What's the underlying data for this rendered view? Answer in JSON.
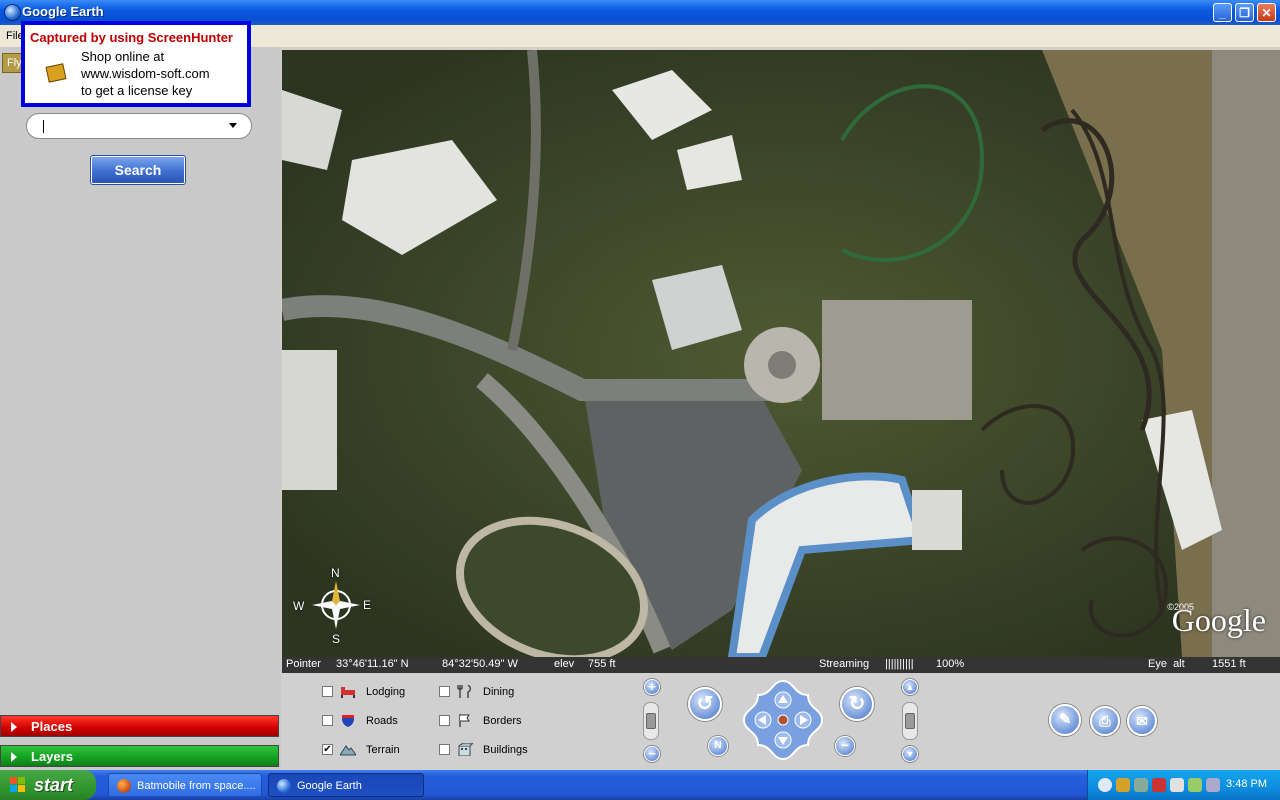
{
  "window": {
    "title": "Google Earth",
    "buttons": {
      "minimize": "_",
      "maximize": "❐",
      "close": "✕"
    }
  },
  "menubar": {
    "first_item": "File"
  },
  "left_panel": {
    "fly_tab": "Fly",
    "search_value": "",
    "search_button": "Search",
    "places": "Places",
    "layers": "Layers"
  },
  "watermark": {
    "title": "Captured by using ScreenHunter",
    "line1": "Shop online at",
    "line2": "www.wisdom-soft.com",
    "line3": "to get a license key"
  },
  "map": {
    "compass": {
      "n": "N",
      "s": "S",
      "e": "E",
      "w": "W"
    },
    "logo": "Google",
    "copyright": "©2005"
  },
  "status": {
    "pointer_label": "Pointer",
    "latitude": "33°46'11.16\" N",
    "longitude": "84°32'50.49\" W",
    "elev_label": "elev",
    "elev_value": "755 ft",
    "streaming_label": "Streaming",
    "streaming_bars": "||||||||||",
    "streaming_percent": "100%",
    "eye_alt_label": "Eye  alt",
    "eye_alt_value": "1551 ft",
    "streaming_progress": 1.0
  },
  "layers": [
    {
      "name": "Lodging",
      "checked": false,
      "icon": "bed-icon"
    },
    {
      "name": "Dining",
      "checked": false,
      "icon": "fork-knife-icon"
    },
    {
      "name": "Roads",
      "checked": false,
      "icon": "interstate-shield-icon"
    },
    {
      "name": "Borders",
      "checked": false,
      "icon": "flag-icon"
    },
    {
      "name": "Terrain",
      "checked": true,
      "icon": "mountain-icon"
    },
    {
      "name": "Buildings",
      "checked": false,
      "icon": "building-icon"
    }
  ],
  "taskbar": {
    "start": "start",
    "items": [
      {
        "label": "Batmobile from space....",
        "icon": "firefox-icon",
        "active": false
      },
      {
        "label": "Google Earth",
        "icon": "google-earth-icon",
        "active": true
      }
    ],
    "clock": "3:48 PM"
  },
  "colors": {
    "titlebar": "#0a5ae0",
    "places_bar": "#d10000",
    "layers_bar": "#14a020",
    "watermark_border": "#0000e0",
    "watermark_title": "#c00000"
  }
}
